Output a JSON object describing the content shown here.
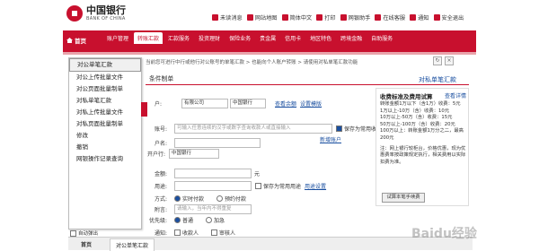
{
  "brand": {
    "cn": "中国银行",
    "en": "BANK OF CHINA"
  },
  "utils": [
    "未读消息",
    "网站地图",
    "简体中文",
    "打印",
    "网银助手",
    "在线客服",
    "通知",
    "安全退出"
  ],
  "nav": {
    "home": "首页",
    "items": [
      "账户管理",
      "转账汇款",
      "汇款服务",
      "投资理财",
      "保险业务",
      "贵金属",
      "信用卡",
      "地区特色",
      "跨境金融",
      "自助服务"
    ]
  },
  "breadcrumb": "当前您可进行中行或他行对公账号的单笔汇款 > 也能向个人账户转账 > 请使用对私单笔汇款功能",
  "subtab": "条件制单",
  "title_right": "对私单笔汇款",
  "dropdown": [
    "对公单笔汇款",
    "对公上传批量文件",
    "对公页面批量制单",
    "对私单笔汇款",
    "对私上传批量文件",
    "对私页面批量制单",
    "修改",
    "撤销",
    "网银操作记录查询"
  ],
  "form": {
    "payee_label": "户:",
    "payee_bank": "有限公司",
    "payee_bank2": "中国银行",
    "view_balance": "查看余额",
    "set_default": "设置模版",
    "payee_acct_label": "账号:",
    "payee_acct_ph": "可输入任意连续的汉字或数字查询收款人或直接输入",
    "save_payee": "保存为常用收款人",
    "add_payee": "新增账户",
    "payee_name_label": "户名:",
    "payee_bank_label": "开户行:",
    "payee_bank_val": "中国银行",
    "amount_label": "金额:",
    "amount_unit": "元",
    "purpose_label": "用途:",
    "save_purpose": "保存为常用用途",
    "purpose_setting": "用途设置",
    "mode_label": "方式:",
    "mode_opt1": "实时付款",
    "mode_opt2": "预约付款",
    "memo_label": "附言:",
    "memo_ph": "请输入，当年内不得重复",
    "priority_label": "优先级:",
    "priority_opt1": "普通",
    "priority_opt2": "加急",
    "notify_label": "通知:",
    "notify_opt1": "收款人",
    "notify_opt2": "审核人"
  },
  "panel": {
    "title": "收费标准及费用试算",
    "link": "查看详情",
    "lines": [
      "转账金额1万以下（含1万）收费：5元",
      "1万以上-10万（含）收费：10元",
      "10万以上-50万（含）收费：15元",
      "50万以上-100万（含）收费：20元",
      "100万以上：转账金额1万分之二，最高200元",
      "注：网上银行较柜台，价格优惠，现为优惠费率按政策规定执行，相关费用以实际扣费为准。"
    ],
    "button": "试算本笔手续费"
  },
  "bottom": {
    "home": "首页",
    "current": "对公单笔汇款",
    "autopop": "自动弹出"
  },
  "watermark": "Baidu经验"
}
